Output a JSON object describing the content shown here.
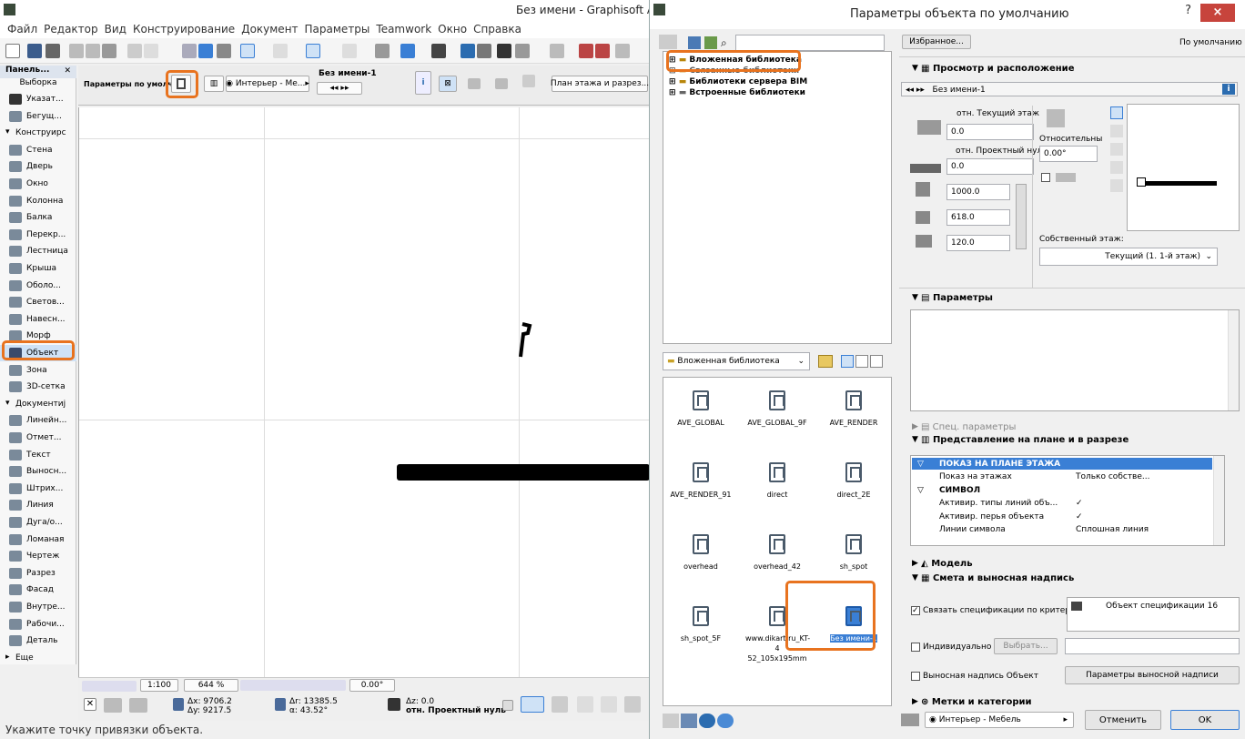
{
  "main": {
    "title": "Без имени - Graphisoft Ar",
    "menu": [
      "Файл",
      "Редактор",
      "Вид",
      "Конструирование",
      "Документ",
      "Параметры",
      "Teamwork",
      "Окно",
      "Справка"
    ],
    "toolbox": {
      "title": "Панель...",
      "select": "Выборка",
      "items": [
        {
          "label": "Указат...",
          "icon": "pointer-icon",
          "sel": false
        },
        {
          "label": "Бегущ...",
          "icon": "marquee-icon",
          "sel": false
        },
        {
          "label": "Конструирс",
          "icon": "section-arrow-icon",
          "section": true
        },
        {
          "label": "Стена",
          "icon": "wall-icon"
        },
        {
          "label": "Дверь",
          "icon": "door-icon"
        },
        {
          "label": "Окно",
          "icon": "window-icon"
        },
        {
          "label": "Колонна",
          "icon": "column-icon"
        },
        {
          "label": "Балка",
          "icon": "beam-icon"
        },
        {
          "label": "Перекр...",
          "icon": "slab-icon"
        },
        {
          "label": "Лестница",
          "icon": "stair-icon"
        },
        {
          "label": "Крыша",
          "icon": "roof-icon"
        },
        {
          "label": "Оболо...",
          "icon": "shell-icon"
        },
        {
          "label": "Светов...",
          "icon": "skylight-icon"
        },
        {
          "label": "Навесн...",
          "icon": "curtain-wall-icon"
        },
        {
          "label": "Морф",
          "icon": "morph-icon"
        },
        {
          "label": "Объект",
          "icon": "object-icon",
          "sel": true
        },
        {
          "label": "Зона",
          "icon": "zone-icon"
        },
        {
          "label": "3D-сетка",
          "icon": "mesh-icon"
        },
        {
          "label": "Документиј",
          "icon": "section-arrow-icon",
          "section": true
        },
        {
          "label": "Линейн...",
          "icon": "dimension-icon"
        },
        {
          "label": "Отмет...",
          "icon": "level-icon"
        },
        {
          "label": "Текст",
          "icon": "text-icon"
        },
        {
          "label": "Выносн...",
          "icon": "label-icon"
        },
        {
          "label": "Штрих...",
          "icon": "fill-icon"
        },
        {
          "label": "Линия",
          "icon": "line-icon"
        },
        {
          "label": "Дуга/о...",
          "icon": "arc-icon"
        },
        {
          "label": "Ломаная",
          "icon": "polyline-icon"
        },
        {
          "label": "Чертеж",
          "icon": "drawing-icon"
        },
        {
          "label": "Разрез",
          "icon": "section-icon"
        },
        {
          "label": "Фасад",
          "icon": "elevation-icon"
        },
        {
          "label": "Внутре...",
          "icon": "interior-icon"
        },
        {
          "label": "Рабочи...",
          "icon": "worksheet-icon"
        },
        {
          "label": "Деталь",
          "icon": "detail-icon"
        },
        {
          "label": "Еще",
          "icon": "section-arrow-icon",
          "section": true
        }
      ]
    },
    "infobox": {
      "default_label": "Параметры по умолч.",
      "interior": "Интерьер - Ме...",
      "name": "Без имени-1",
      "plan": "План этажа и разрез..."
    },
    "status": {
      "scale": "1:100",
      "zoom": "644 %",
      "angle": "0.00°",
      "dx": "Δx: 9706.2",
      "dy": "Δy: 9217.5",
      "dr": "Δr: 13385.5",
      "da": "α: 43.52°",
      "dz": "Δz: 0.0",
      "ref": "отн. Проектный нуль"
    },
    "prompt": "Укажите точку привязки объекта."
  },
  "dialog": {
    "title": "Параметры объекта по умолчанию",
    "help": "?",
    "close": "×",
    "tree": [
      "Вложенная библиотека",
      "Связанные библиотеки",
      "Библиотеки сервера BIM",
      "Встроенные библиотеки"
    ],
    "folder": "Вложенная библиотека",
    "objects": [
      {
        "name": "AVE_GLOBAL"
      },
      {
        "name": "AVE_GLOBAL_9F"
      },
      {
        "name": "AVE_RENDER"
      },
      {
        "name": "AVE_RENDER_91"
      },
      {
        "name": "direct"
      },
      {
        "name": "direct_2E"
      },
      {
        "name": "overhead"
      },
      {
        "name": "overhead_42"
      },
      {
        "name": "sh_spot"
      },
      {
        "name": "sh_spot_5F"
      },
      {
        "name": "www.dikart.ru_KT-4 52_105x195mm"
      },
      {
        "name": "Без имени-1",
        "selected": true
      }
    ],
    "favorites": "Избранное...",
    "default_btn": "По умолчанию",
    "preview": {
      "header": "Просмотр и расположение",
      "name": "Без имени-1",
      "rel_floor": "отн. Текущий этаж",
      "elev1": "0.0",
      "rel_label": "Относительны",
      "angle": "0.00°",
      "rel_project": "отн. Проектный нуль",
      "elev2": "0.0",
      "w": "1000.0",
      "d": "618.0",
      "h": "120.0",
      "home_story": "Собственный этаж:",
      "home_story_val": "Текущий (1. 1-й этаж)"
    },
    "params_header": "Параметры",
    "special_header": "Спец. параметры",
    "repr_header": "Представление на плане и в разрезе",
    "repr_rows": [
      {
        "c1": "ПОКАЗ НА ПЛАНЕ ЭТАЖА",
        "c2": "",
        "head": true,
        "selected": true
      },
      {
        "c1": "Показ на этажах",
        "c2": "Только собстве...",
        "head": false
      },
      {
        "c1": "СИМВОЛ",
        "c2": "",
        "head": true
      },
      {
        "c1": "Активир. типы линий объ...",
        "c2": "✓",
        "head": false
      },
      {
        "c1": "Активир. перья объекта",
        "c2": "✓",
        "head": false
      },
      {
        "c1": "Линии символа",
        "c2": "Сплошная линия",
        "head": false
      }
    ],
    "model_header": "Модель",
    "listing_header": "Смета и выносная надпись",
    "link_spec": "Связать спецификации по критериям",
    "spec_object": "Объект спецификации 16",
    "individual": "Индивидуально",
    "select_btn": "Выбрать...",
    "label_obj": "Выносная надпись Объект",
    "label_params": "Параметры выносной надписи",
    "tags_header": "Метки и категории",
    "layer": "Интерьер - Мебель",
    "cancel": "Отменить",
    "ok": "OK"
  }
}
